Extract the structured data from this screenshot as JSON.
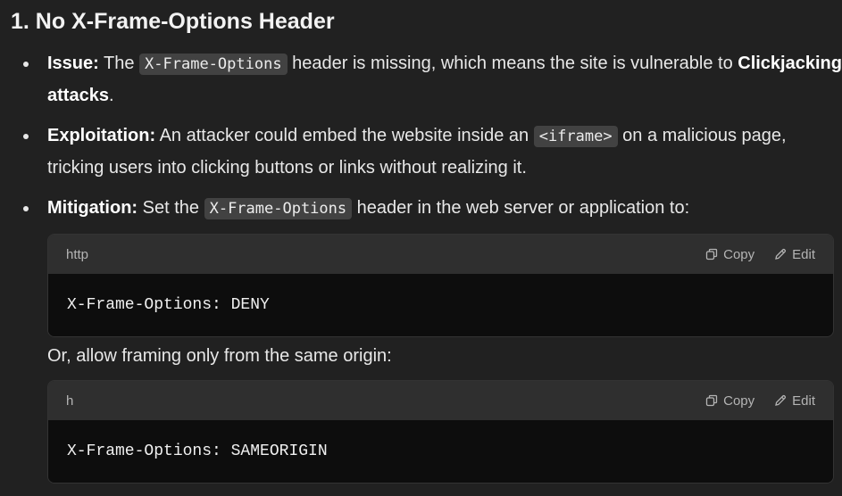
{
  "section": {
    "heading": "1. No X-Frame-Options Header"
  },
  "items": [
    {
      "label": "Issue:",
      "text_1": " The ",
      "code_1": "X-Frame-Options",
      "text_2": " header is missing, which means the site is vulnerable to ",
      "strong_1": "Clickjacking attacks",
      "text_3": "."
    },
    {
      "label": "Exploitation:",
      "text_1": " An attacker could embed the website inside an ",
      "code_1": "<iframe>",
      "text_2": " on a malicious page, tricking users into clicking buttons or links without realizing it."
    },
    {
      "label": "Mitigation:",
      "text_1": " Set the ",
      "code_1": "X-Frame-Options",
      "text_2": " header in the web server or application to:"
    }
  ],
  "codeblocks": [
    {
      "language": "http",
      "code": "X-Frame-Options: DENY",
      "copy_label": "Copy",
      "edit_label": "Edit"
    },
    {
      "language": "h",
      "code": "X-Frame-Options: SAMEORIGIN",
      "copy_label": "Copy",
      "edit_label": "Edit"
    }
  ],
  "between_text": "Or, allow framing only from the same origin:"
}
